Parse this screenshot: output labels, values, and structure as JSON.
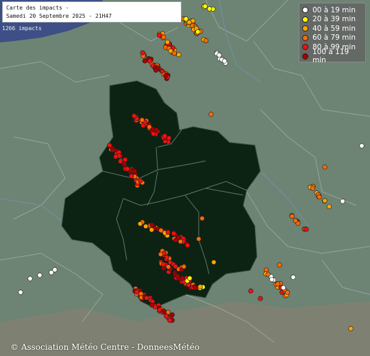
{
  "title": {
    "line1": "Carte des impacts -",
    "line2": "Samedi 20 Septembre 2025 - 21H47"
  },
  "impact_count": "1266 impacts",
  "legend": [
    {
      "label": "00 à 19 min",
      "color": "#ffffff"
    },
    {
      "label": "20 à 39 min",
      "color": "#ffff00"
    },
    {
      "label": "40 à 59 min",
      "color": "#ffa500"
    },
    {
      "label": "60 à 79 min",
      "color": "#ff6a00"
    },
    {
      "label": "80 à 99 min",
      "color": "#ee1111"
    },
    {
      "label": "100 à 119 min",
      "color": "#aa0000"
    }
  ],
  "copyright": "© Association Météo Centre - DonneesMétéo"
}
